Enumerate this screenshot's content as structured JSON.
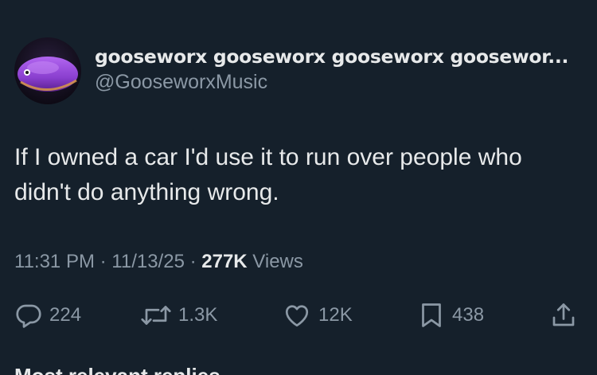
{
  "author": {
    "display_name": "gooseworx gooseworx gooseworx goosewor...",
    "handle": "@GooseworxMusic"
  },
  "tweet": {
    "text": "If I owned a car I'd use it to run over people who didn't do anything wrong."
  },
  "meta": {
    "time": "11:31 PM",
    "separator1": " · ",
    "date": "11/13/25",
    "separator2": " · ",
    "views_count": "277K",
    "views_label": " Views"
  },
  "actions": {
    "replies": "224",
    "reposts": "1.3K",
    "likes": "12K",
    "bookmarks": "438"
  },
  "replies_section": {
    "label": "Most relevant replies"
  },
  "icons": {
    "reply": "reply-icon",
    "repost": "repost-icon",
    "like": "heart-icon",
    "bookmark": "bookmark-icon",
    "share": "share-icon"
  },
  "colors": {
    "background": "#15202b",
    "primary_text": "#e7e9ea",
    "secondary_text": "#8b98a5"
  }
}
